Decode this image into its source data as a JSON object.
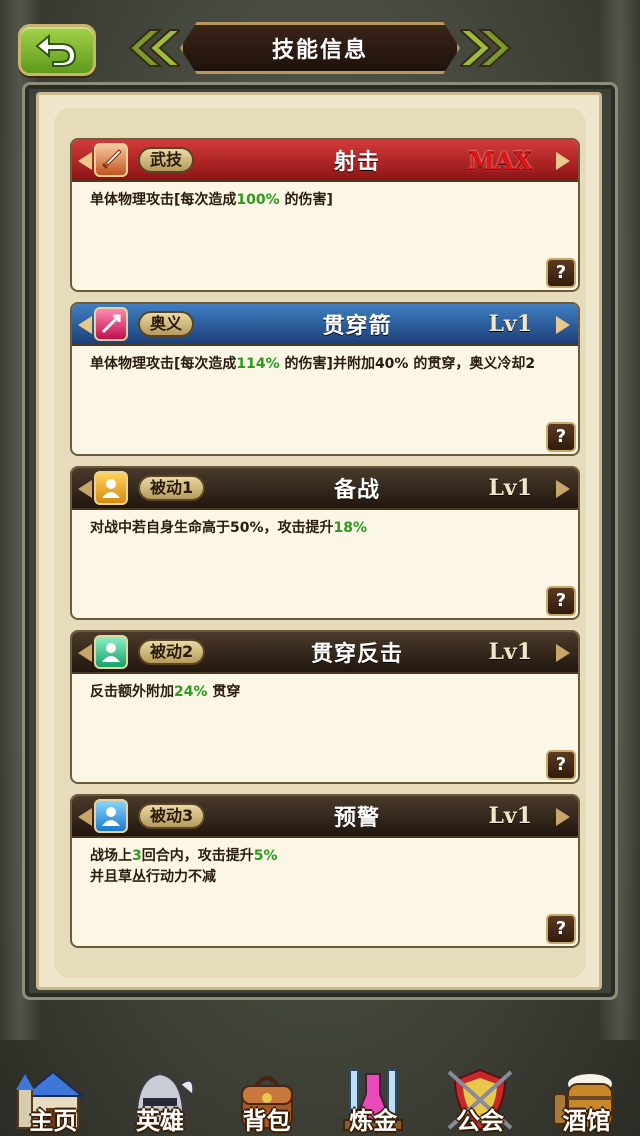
{
  "header": {
    "title": "技能信息"
  },
  "skills": [
    {
      "type": "武技",
      "name": "射击",
      "level": "MAX",
      "desc_parts": [
        "单体物理攻击[每次造成",
        "100%",
        " 的伤害]"
      ],
      "icon": "sword-icon",
      "theme": "red"
    },
    {
      "type": "奥义",
      "name": "贯穿箭",
      "level": "Lv1",
      "desc_parts": [
        "单体物理攻击[每次造成",
        "114%",
        " 的伤害]并附加40% 的贯穿，奥义冷却2"
      ],
      "icon": "arrow-strike-icon",
      "theme": "blue"
    },
    {
      "type": "被动1",
      "name": "备战",
      "level": "Lv1",
      "desc_parts": [
        "对战中若自身生命高于50%，攻击提升",
        "18%",
        ""
      ],
      "icon": "person-yellow-icon",
      "theme": "dark"
    },
    {
      "type": "被动2",
      "name": "贯穿反击",
      "level": "Lv1",
      "desc_parts": [
        "反击额外附加",
        "24%",
        " 贯穿"
      ],
      "icon": "person-green-icon",
      "theme": "dark"
    },
    {
      "type": "被动3",
      "name": "预警",
      "level": "Lv1",
      "desc_line1_parts": [
        "战场上",
        "3",
        "回合内，攻击提升",
        "5%"
      ],
      "desc_line2": "并且草丛行动力不减",
      "icon": "person-blue-icon",
      "theme": "dark"
    }
  ],
  "help_label": "?",
  "nav": [
    {
      "label": "主页",
      "icon": "castle-icon"
    },
    {
      "label": "英雄",
      "icon": "knight-helmet-icon"
    },
    {
      "label": "背包",
      "icon": "backpack-icon"
    },
    {
      "label": "炼金",
      "icon": "potion-icon"
    },
    {
      "label": "公会",
      "icon": "guild-shield-icon"
    },
    {
      "label": "酒馆",
      "icon": "tavern-barrel-icon"
    }
  ]
}
